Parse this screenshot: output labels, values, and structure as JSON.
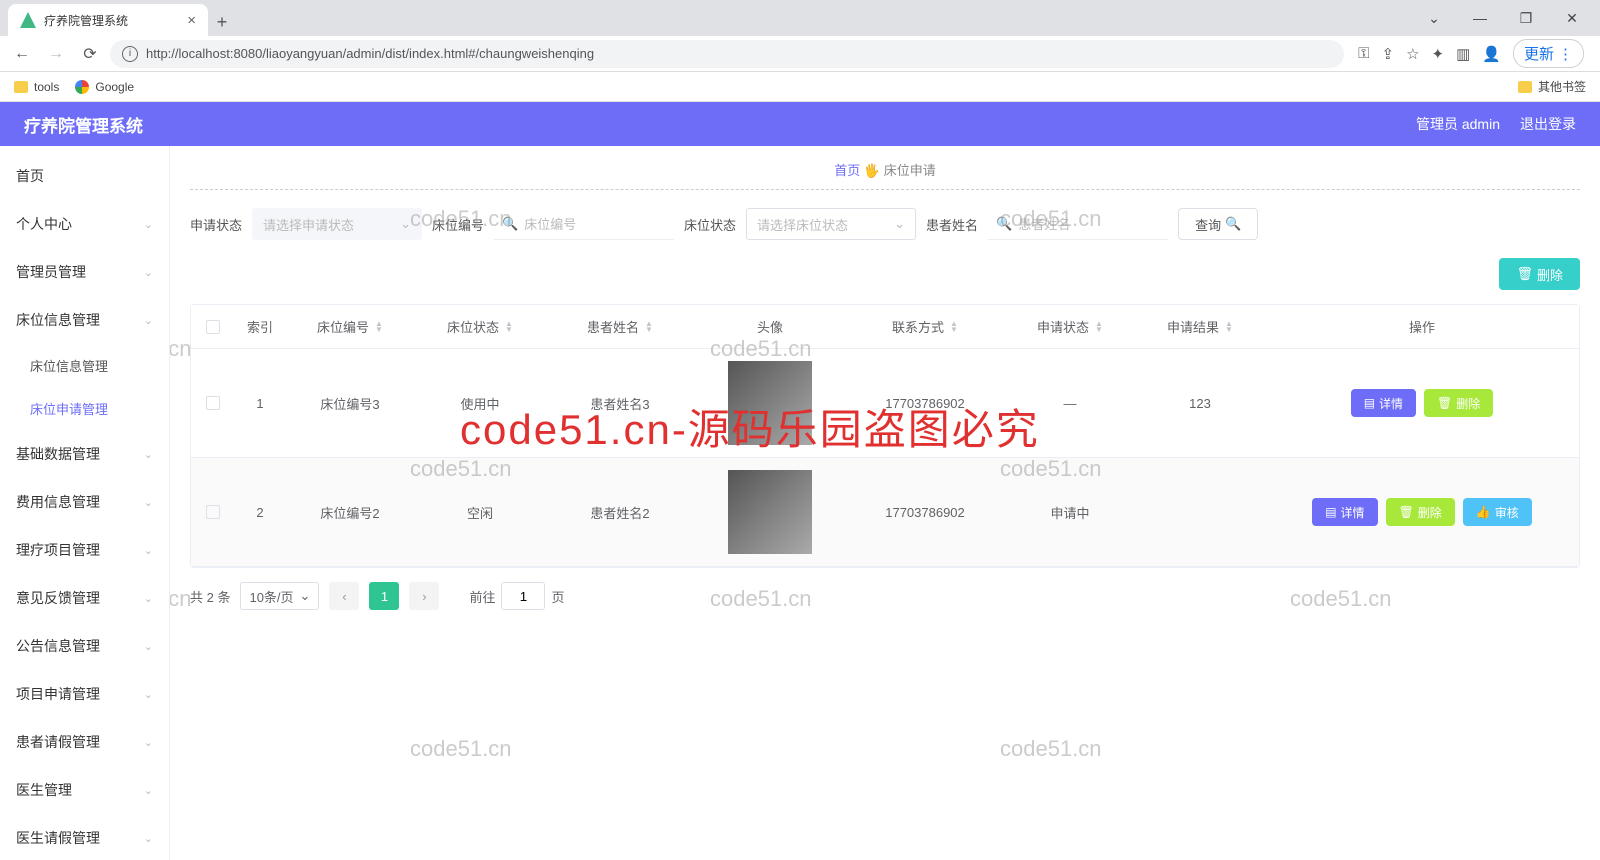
{
  "browser": {
    "tab_title": "疗养院管理系统",
    "url": "http://localhost:8080/liaoyangyuan/admin/dist/index.html#/chaungweishenqing",
    "update_label": "更新",
    "bookmarks": {
      "tools": "tools",
      "google": "Google",
      "other": "其他书签"
    }
  },
  "app": {
    "title": "疗养院管理系统",
    "user_label": "管理员 admin",
    "logout": "退出登录"
  },
  "sidebar": {
    "items": [
      {
        "label": "首页"
      },
      {
        "label": "个人中心"
      },
      {
        "label": "管理员管理"
      },
      {
        "label": "床位信息管理",
        "subs": [
          {
            "label": "床位信息管理"
          },
          {
            "label": "床位申请管理",
            "active": true
          }
        ]
      },
      {
        "label": "基础数据管理"
      },
      {
        "label": "费用信息管理"
      },
      {
        "label": "理疗项目管理"
      },
      {
        "label": "意见反馈管理"
      },
      {
        "label": "公告信息管理"
      },
      {
        "label": "项目申请管理"
      },
      {
        "label": "患者请假管理"
      },
      {
        "label": "医生管理"
      },
      {
        "label": "医生请假管理"
      }
    ]
  },
  "breadcrumb": {
    "home": "首页",
    "sep": "🖐",
    "current": "床位申请"
  },
  "filters": {
    "apply_status_label": "申请状态",
    "apply_status_placeholder": "请选择申请状态",
    "bed_no_label": "床位编号",
    "bed_no_placeholder": "床位编号",
    "bed_status_label": "床位状态",
    "bed_status_placeholder": "请选择床位状态",
    "patient_label": "患者姓名",
    "patient_placeholder": "患者姓名",
    "query_btn": "查询"
  },
  "toolbar": {
    "delete_btn": "删除"
  },
  "table": {
    "headers": {
      "index": "索引",
      "bed_no": "床位编号",
      "bed_status": "床位状态",
      "patient": "患者姓名",
      "avatar": "头像",
      "phone": "联系方式",
      "apply_status": "申请状态",
      "apply_result": "申请结果",
      "ops": "操作"
    },
    "ops": {
      "detail": "详情",
      "delete": "删除",
      "review": "审核"
    },
    "rows": [
      {
        "idx": "1",
        "bed_no": "床位编号3",
        "bed_status": "使用中",
        "patient": "患者姓名3",
        "phone": "17703786902",
        "apply_status": "—",
        "apply_result": "123",
        "has_review": false
      },
      {
        "idx": "2",
        "bed_no": "床位编号2",
        "bed_status": "空闲",
        "patient": "患者姓名2",
        "phone": "17703786902",
        "apply_status": "申请中",
        "apply_result": "",
        "has_review": true
      }
    ]
  },
  "pager": {
    "total_text": "共 2 条",
    "page_size": "10条/页",
    "current": "1",
    "jump_prefix": "前往",
    "jump_value": "1",
    "jump_suffix": "页"
  },
  "watermark": "code51.cn",
  "watermark_red": "code51.cn-源码乐园盗图必究"
}
